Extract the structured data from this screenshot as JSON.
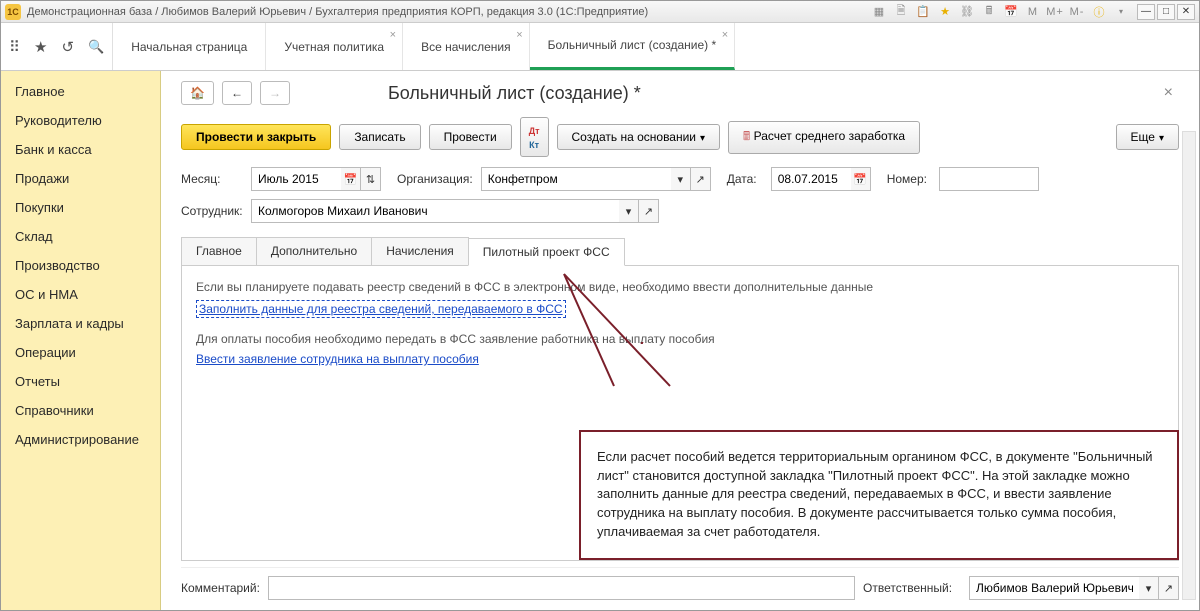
{
  "window": {
    "title": "Демонстрационная база / Любимов Валерий Юрьевич / Бухгалтерия предприятия КОРП, редакция 3.0  (1С:Предприятие)",
    "m_labels": [
      "M",
      "M+",
      "M-"
    ]
  },
  "topTabs": [
    {
      "label": "Начальная страница",
      "closable": false
    },
    {
      "label": "Учетная политика",
      "closable": true
    },
    {
      "label": "Все начисления",
      "closable": true
    },
    {
      "label": "Больничный лист (создание) *",
      "closable": true,
      "active": true
    }
  ],
  "sidebar": {
    "items": [
      "Главное",
      "Руководителю",
      "Банк и касса",
      "Продажи",
      "Покупки",
      "Склад",
      "Производство",
      "ОС и НМА",
      "Зарплата и кадры",
      "Операции",
      "Отчеты",
      "Справочники",
      "Администрирование"
    ]
  },
  "page": {
    "title": "Больничный лист (создание) *"
  },
  "actions": {
    "submit_close": "Провести и закрыть",
    "write": "Записать",
    "submit": "Провести",
    "dtkt": "Дт\nКт",
    "create_based": "Создать на основании",
    "calc_avg": "Расчет среднего заработка",
    "more": "Еще"
  },
  "form": {
    "month_label": "Месяц:",
    "month_value": "Июль 2015",
    "org_label": "Организация:",
    "org_value": "Конфетпром",
    "date_label": "Дата:",
    "date_value": "08.07.2015",
    "number_label": "Номер:",
    "number_value": "",
    "employee_label": "Сотрудник:",
    "employee_value": "Колмогоров Михаил Иванович"
  },
  "subtabs": [
    "Главное",
    "Дополнительно",
    "Начисления",
    "Пилотный проект ФСС"
  ],
  "activeSubtab": 3,
  "content": {
    "p1": "Если вы планируете подавать реестр сведений в ФСС в электронном виде, необходимо ввести дополнительные данные",
    "link1": "Заполнить данные для реестра сведений, передаваемого  в ФСС",
    "p2": "Для оплаты пособия необходимо передать в ФСС заявление работника на выплату пособия",
    "link2": "Ввести заявление сотрудника на выплату пособия"
  },
  "callout": "Если расчет пособий ведется территориальным органином ФСС, в документе \"Больничный лист\" становится доступной закладка \"Пилотный проект ФСС\". На этой закладке можно заполнить данные для реестра сведений, передаваемых в ФСС, и ввести заявление сотрудника на выплату пособия. В документе рассчитывается только сумма пособия, уплачиваемая за счет работодателя.",
  "bottom": {
    "comment_label": "Комментарий:",
    "comment_value": "",
    "responsible_label": "Ответственный:",
    "responsible_value": "Любимов Валерий Юрьевич"
  }
}
